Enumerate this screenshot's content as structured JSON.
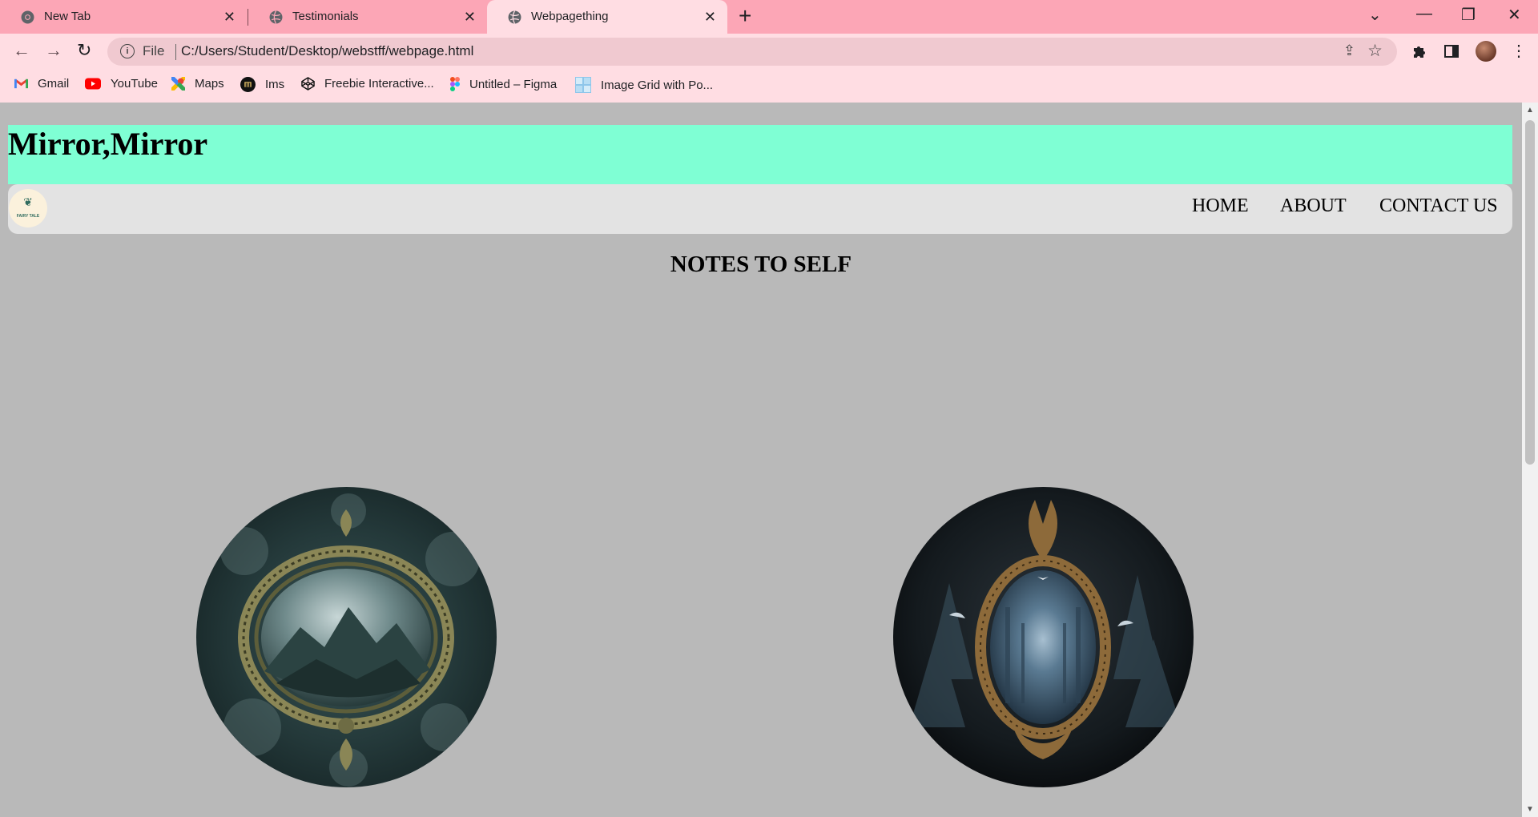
{
  "browser": {
    "tabs": [
      {
        "title": "New Tab"
      },
      {
        "title": "Testimonials"
      },
      {
        "title": "Webpagething"
      }
    ],
    "address": {
      "scheme": "File",
      "url": "C:/Users/Student/Desktop/webstff/webpage.html"
    },
    "bookmarks": [
      {
        "label": "Gmail"
      },
      {
        "label": "YouTube"
      },
      {
        "label": "Maps"
      },
      {
        "label": "Ims"
      },
      {
        "label": "Freebie Interactive..."
      },
      {
        "label": "Untitled – Figma"
      },
      {
        "label": "Image Grid with Po..."
      }
    ]
  },
  "page": {
    "title": "Mirror,Mirror",
    "logo_text": "FAIRY TALE",
    "nav": [
      "HOME",
      "ABOUT",
      "CONTACT US"
    ],
    "heading": "NOTES TO SELF",
    "colors": {
      "header_bg": "#7fffd4",
      "nav_bg": "#e3e3e3",
      "page_bg": "#b9b9b9",
      "tab_strip": "#fca6b6",
      "active_tab": "#ffdde3"
    }
  }
}
